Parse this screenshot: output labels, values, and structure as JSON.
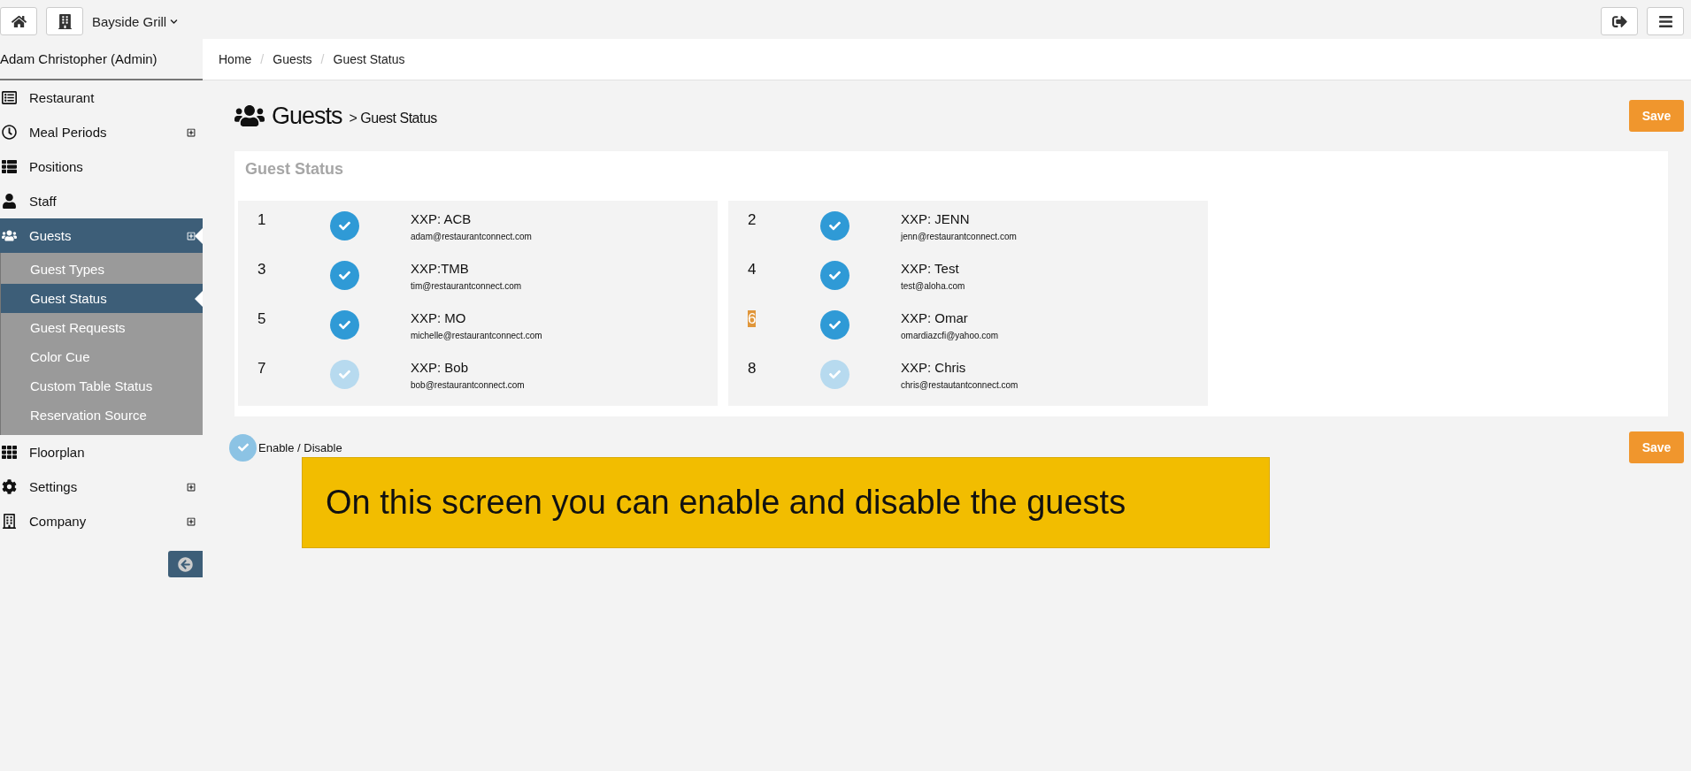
{
  "topbar": {
    "venue": "Bayside Grill"
  },
  "sidebar": {
    "user": "Adam Christopher (Admin)",
    "items": [
      {
        "label": "Restaurant",
        "expandable": false,
        "selected": false
      },
      {
        "label": "Meal Periods",
        "expandable": true,
        "selected": false
      },
      {
        "label": "Positions",
        "expandable": false,
        "selected": false
      },
      {
        "label": "Staff",
        "expandable": false,
        "selected": false
      },
      {
        "label": "Guests",
        "expandable": true,
        "selected": true,
        "children": [
          {
            "label": "Guest Types",
            "selected": false
          },
          {
            "label": "Guest Status",
            "selected": true
          },
          {
            "label": "Guest Requests",
            "selected": false
          },
          {
            "label": "Color Cue",
            "selected": false
          },
          {
            "label": "Custom Table Status",
            "selected": false
          },
          {
            "label": "Reservation Source",
            "selected": false
          }
        ]
      },
      {
        "label": "Floorplan",
        "expandable": false,
        "selected": false
      },
      {
        "label": "Settings",
        "expandable": true,
        "selected": false
      },
      {
        "label": "Company",
        "expandable": true,
        "selected": false
      }
    ]
  },
  "breadcrumb": {
    "separator": "/",
    "items": [
      "Home",
      "Guests",
      "Guest Status"
    ]
  },
  "header": {
    "title": "Guests",
    "subtitle": "> Guest Status",
    "save": "Save"
  },
  "panel": {
    "title": "Guest Status",
    "columns": [
      [
        {
          "number": "1",
          "enabled": true,
          "name": "XXP: ACB",
          "email": "adam@restaurantconnect.com"
        },
        {
          "number": "3",
          "enabled": true,
          "name": "XXP:TMB",
          "email": "tim@restaurantconnect.com"
        },
        {
          "number": "5",
          "enabled": true,
          "name": "XXP: MO",
          "email": "michelle@restaurantconnect.com"
        },
        {
          "number": "7",
          "enabled": false,
          "name": "XXP: Bob",
          "email": "bob@restaurantconnect.com"
        }
      ],
      [
        {
          "number": "2",
          "enabled": true,
          "name": "XXP: JENN",
          "email": "jenn@restaurantconnect.com"
        },
        {
          "number": "4",
          "enabled": true,
          "name": "XXP: Test",
          "email": "test@aloha.com"
        },
        {
          "number": "6",
          "enabled": true,
          "name": "XXP: Omar",
          "email": "omardiazcfi@yahoo.com",
          "text_selected": true
        },
        {
          "number": "8",
          "enabled": false,
          "name": "XXP: Chris",
          "email": "chris@restautantconnect.com"
        }
      ]
    ]
  },
  "legend": {
    "label": "Enable / Disable",
    "save": "Save"
  },
  "caption": "On this screen you can enable and disable the guests"
}
